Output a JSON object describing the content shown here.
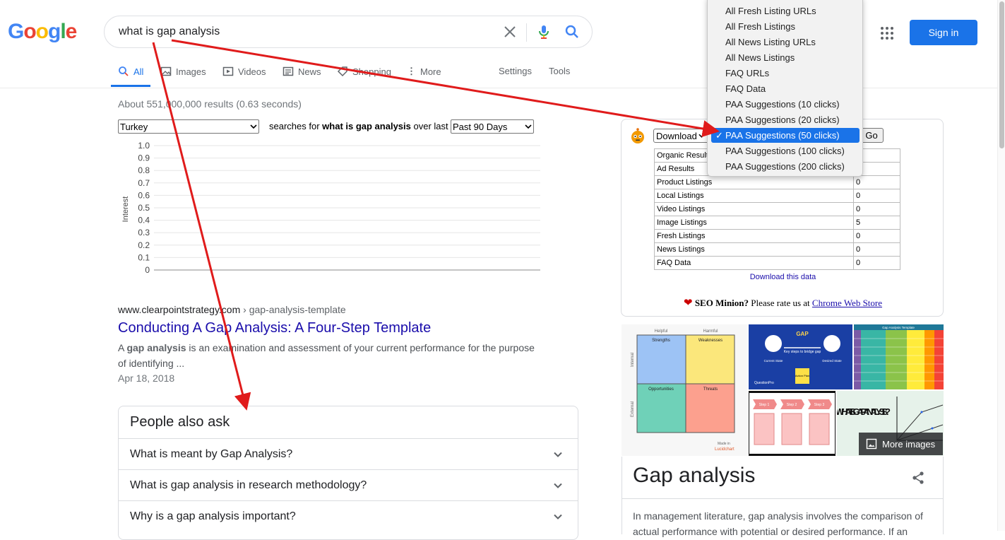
{
  "header": {
    "logo_letters": [
      "G",
      "o",
      "o",
      "g",
      "l",
      "e"
    ],
    "logo_colors": [
      "#4285f4",
      "#ea4335",
      "#fbbc05",
      "#4285f4",
      "#34a853",
      "#ea4335"
    ],
    "query": "what is gap analysis",
    "signin_label": "Sign in"
  },
  "tabs": {
    "all": "All",
    "images": "Images",
    "videos": "Videos",
    "news": "News",
    "shopping": "Shopping",
    "more": "More",
    "settings": "Settings",
    "tools": "Tools"
  },
  "stats_text": "About 551,000,000 results (0.63 seconds)",
  "trends": {
    "country": "Turkey",
    "prefix": "searches for ",
    "term": "what is gap analysis",
    "suffix": " over last",
    "period": "Past 90 Days"
  },
  "chart_data": {
    "type": "line",
    "title": "",
    "xlabel": "",
    "ylabel": "Interest",
    "ylim": [
      0,
      1.0
    ],
    "yticks": [
      "1.0",
      "0.9",
      "0.8",
      "0.7",
      "0.6",
      "0.5",
      "0.4",
      "0.3",
      "0.2",
      "0.1",
      "0"
    ],
    "series": [],
    "grid": true
  },
  "result": {
    "domain": "www.clearpointstrategy.com",
    "crumb": " › gap-analysis-template",
    "title": "Conducting A Gap Analysis: A Four-Step Template",
    "snippet_pre": "A ",
    "snippet_bold": "gap analysis",
    "snippet_post": " is an examination and assessment of your current performance for the purpose of identifying ...",
    "date": "Apr 18, 2018"
  },
  "paa": {
    "title": "People also ask",
    "questions": [
      "What is meant by Gap Analysis?",
      "What is gap analysis in research methodology?",
      "Why is a gap analysis important?"
    ]
  },
  "widget": {
    "download_select": "Download",
    "go_label": "Go",
    "rows": [
      {
        "label": "Organic Results",
        "value": ""
      },
      {
        "label": "Ad Results",
        "value": ""
      },
      {
        "label": "Product Listings",
        "value": "0"
      },
      {
        "label": "Local Listings",
        "value": "0"
      },
      {
        "label": "Video Listings",
        "value": "0"
      },
      {
        "label": "Image Listings",
        "value": "5"
      },
      {
        "label": "Fresh Listings",
        "value": "0"
      },
      {
        "label": "News Listings",
        "value": "0"
      },
      {
        "label": "FAQ Data",
        "value": "0"
      }
    ],
    "download_link": "Download this data",
    "rate_heart": "❤",
    "rate_bold": "SEO Minion?",
    "rate_mid": " Please rate us at ",
    "rate_link": "Chrome Web Store"
  },
  "dropdown": {
    "items": [
      "All Fresh Listing URLs",
      "All Fresh Listings",
      "All News Listing URLs",
      "All News Listings",
      "FAQ URLs",
      "FAQ Data",
      "PAA Suggestions (10 clicks)",
      "PAA Suggestions (20 clicks)",
      "PAA Suggestions (50 clicks)",
      "PAA Suggestions (100 clicks)",
      "PAA Suggestions (200 clicks)"
    ],
    "selected_index": 8,
    "check": "✓"
  },
  "images": {
    "more_label": "More images",
    "swot": {
      "helpful": "Helpful",
      "harmful": "Harmful",
      "internal": "Internal",
      "external": "External",
      "strengths": "Strengths",
      "weaknesses": "Weaknesses",
      "opportunities": "Opportunities",
      "threats": "Threats",
      "made_in": "Made in",
      "brand": "Lucidchart"
    },
    "gap": {
      "title": "GAP",
      "subtitle": "Key steps to bridge gap",
      "current": "Current State",
      "desired": "Desired State",
      "plan": "Action Plan",
      "brand": "QuestionPro"
    },
    "gap_template_title": "Gap Analysis Template",
    "steps": [
      "Step 1",
      "Step 2",
      "Step 3"
    ],
    "wig_text": "WHAT IS GAP ANALYSIS?"
  },
  "knowledge": {
    "title": "Gap analysis",
    "description": "In management literature, gap analysis involves the comparison of actual performance with potential or desired performance. If an"
  }
}
